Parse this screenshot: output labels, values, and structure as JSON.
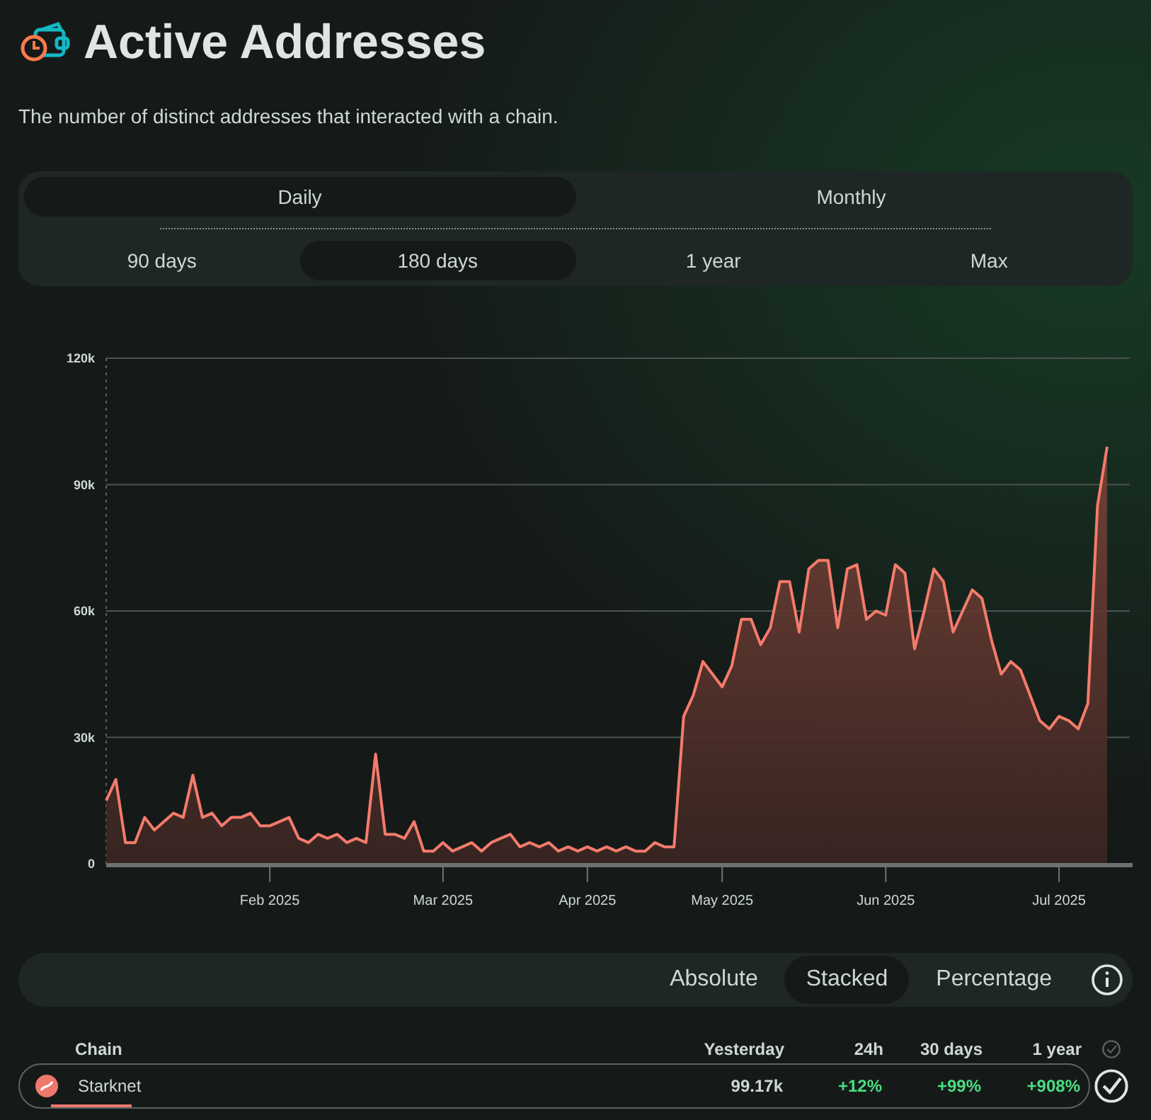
{
  "header": {
    "title": "Active Addresses",
    "description": "The number of distinct addresses that interacted with a chain."
  },
  "interval_tabs": [
    {
      "label": "Daily",
      "selected": true
    },
    {
      "label": "Monthly",
      "selected": false
    }
  ],
  "range_tabs": [
    {
      "label": "90 days",
      "selected": false
    },
    {
      "label": "180 days",
      "selected": true
    },
    {
      "label": "1 year",
      "selected": false
    },
    {
      "label": "Max",
      "selected": false
    }
  ],
  "chart": {
    "chart_data": {
      "type": "area",
      "categories": [
        null,
        null,
        null,
        null,
        null,
        null,
        null,
        null,
        null,
        null,
        null,
        null,
        null,
        null,
        null,
        null,
        null,
        "Feb 2025",
        null,
        null,
        null,
        null,
        null,
        null,
        null,
        null,
        null,
        null,
        null,
        null,
        null,
        null,
        null,
        null,
        null,
        "Mar 2025",
        null,
        null,
        null,
        null,
        null,
        null,
        null,
        null,
        null,
        null,
        null,
        null,
        null,
        null,
        "Apr 2025",
        null,
        null,
        null,
        null,
        null,
        null,
        null,
        null,
        null,
        null,
        null,
        null,
        null,
        "May 2025",
        null,
        null,
        null,
        null,
        null,
        null,
        null,
        null,
        null,
        null,
        null,
        null,
        null,
        null,
        null,
        null,
        "Jun 2025",
        null,
        null,
        null,
        null,
        null,
        null,
        null,
        null,
        null,
        null,
        null,
        null,
        null,
        null,
        null,
        null,
        null,
        "Jul 2025",
        null,
        null,
        null,
        null,
        null
      ],
      "series": [
        {
          "color": "#f47b6b",
          "values": [
            15000,
            20000,
            5000,
            5000,
            11000,
            8000,
            10000,
            12000,
            11000,
            21000,
            11000,
            12000,
            9000,
            11000,
            11000,
            12000,
            9000,
            9000,
            10000,
            11000,
            6000,
            5000,
            7000,
            6000,
            7000,
            5000,
            6000,
            5000,
            26000,
            7000,
            7000,
            6000,
            10000,
            3000,
            3000,
            5000,
            3000,
            4000,
            5000,
            3000,
            5000,
            6000,
            7000,
            4000,
            5000,
            4000,
            5000,
            3000,
            4000,
            3000,
            4000,
            3000,
            4000,
            3000,
            4000,
            3000,
            3000,
            5000,
            4000,
            4000,
            35000,
            40000,
            48000,
            45000,
            42000,
            47000,
            58000,
            58000,
            52000,
            56000,
            67000,
            67000,
            55000,
            70000,
            72000,
            72000,
            56000,
            70000,
            71000,
            58000,
            60000,
            59000,
            71000,
            69000,
            51000,
            60000,
            70000,
            67000,
            55000,
            60000,
            65000,
            63000,
            53000,
            45000,
            48000,
            46000,
            40000,
            34000,
            32000,
            35000,
            34000,
            32000,
            38000,
            85000,
            99000
          ]
        }
      ],
      "grid": true,
      "ylim": [
        0,
        120000
      ],
      "yticks": [
        {
          "value": 0,
          "label": "0"
        },
        {
          "value": 30000,
          "label": "30k"
        },
        {
          "value": 60000,
          "label": "60k"
        },
        {
          "value": 90000,
          "label": "90k"
        },
        {
          "value": 120000,
          "label": "120k"
        }
      ]
    }
  },
  "scale_tabs": [
    {
      "label": "Absolute",
      "selected": false
    },
    {
      "label": "Stacked",
      "selected": true
    },
    {
      "label": "Percentage",
      "selected": false
    }
  ],
  "table": {
    "columns": [
      "Chain",
      "Yesterday",
      "24h",
      "30 days",
      "1 year"
    ],
    "rows": [
      {
        "chain": "Starknet",
        "yesterday": "99.17k",
        "change_24h": "+12%",
        "change_30d": "+99%",
        "change_1y": "+908%",
        "level": 0.08,
        "selected": true
      }
    ]
  }
}
